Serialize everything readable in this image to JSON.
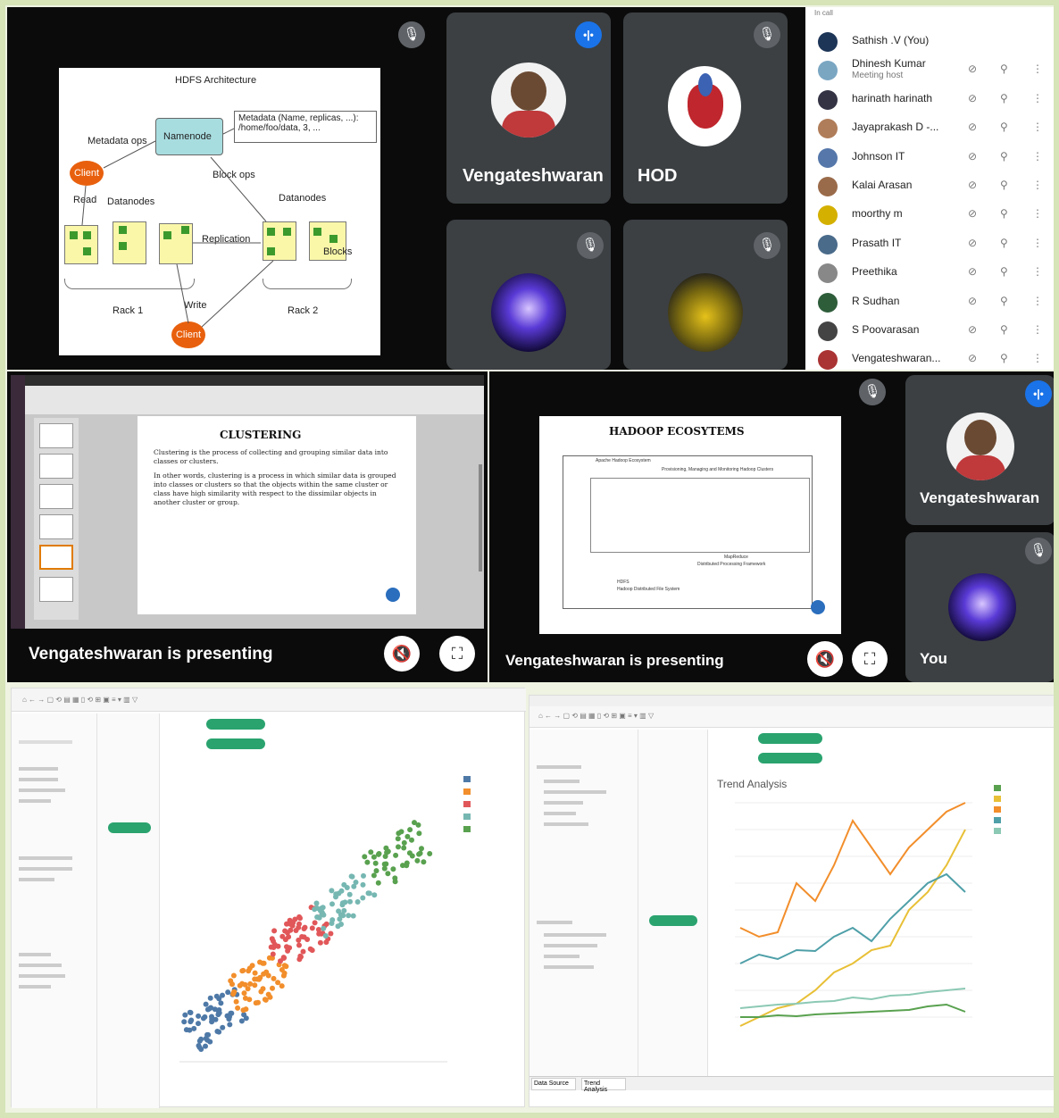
{
  "hdfs_slide": {
    "title": "HDFS Architecture",
    "namenode": "Namenode",
    "metadata": "Metadata (Name, replicas, ...):\n/home/foo/data, 3, ...",
    "metadata_ops": "Metadata ops",
    "client": "Client",
    "block_ops": "Block ops",
    "read": "Read",
    "datanodes_left": "Datanodes",
    "datanodes_right": "Datanodes",
    "replication": "Replication",
    "blocks": "Blocks",
    "rack1": "Rack 1",
    "rack2": "Rack 2",
    "write": "Write",
    "client2": "Client"
  },
  "tiles": {
    "vengateshwaran_top": "Vengateshwaran",
    "hod": "HOD",
    "vengateshwaran_right": "Vengateshwaran",
    "you": "You"
  },
  "people_panel": {
    "header": "In call",
    "participants": [
      {
        "name": "Sathish .V (You)",
        "sub": "",
        "color": "#1d3557"
      },
      {
        "name": "Dhinesh Kumar",
        "sub": "Meeting host",
        "color": "#7aa6c2"
      },
      {
        "name": "harinath harinath",
        "sub": "",
        "color": "#334"
      },
      {
        "name": "Jayaprakash D -...",
        "sub": "",
        "color": "#b07d5a"
      },
      {
        "name": "Johnson IT",
        "sub": "",
        "color": "#5577aa"
      },
      {
        "name": "Kalai Arasan",
        "sub": "",
        "color": "#9a6b4a"
      },
      {
        "name": "moorthy m",
        "sub": "",
        "color": "#d4b000"
      },
      {
        "name": "Prasath IT",
        "sub": "",
        "color": "#4a6b8a"
      },
      {
        "name": "Preethika",
        "sub": "",
        "color": "#888"
      },
      {
        "name": "R Sudhan",
        "sub": "",
        "color": "#2e5d3a"
      },
      {
        "name": "S Poovarasan",
        "sub": "",
        "color": "#444"
      },
      {
        "name": "Vengateshwaran...",
        "sub": "",
        "color": "#a33"
      }
    ]
  },
  "clustering_slide": {
    "title": "CLUSTERING",
    "bullet1": "Clustering is the process of collecting and grouping similar data into classes or clusters.",
    "bullet2": "In other words, clustering is a process in which similar data is grouped into classes or clusters so that the objects within the same cluster or class have high similarity with respect to the dissimilar objects in another cluster or group."
  },
  "hadoop_slide": {
    "title": "HADOOP ECOSYTEMS",
    "subtitle": "Apache Hadoop Ecosystem",
    "row1": "Provisioning, Managing and Monitoring Hadoop Clusters",
    "row2": "MapReduce",
    "row3": "Distributed Processing Framework",
    "row4": "HDFS",
    "row5": "Hadoop Distributed File System"
  },
  "presenting": {
    "left": "Vengateshwaran is presenting",
    "right": "Vengateshwaran is presenting"
  },
  "tableau_right": {
    "chart_title": "Trend Analysis",
    "tab1": "Data Source",
    "tab2": "Trend Analysis"
  },
  "colors": {
    "meet_tile": "#3c4043",
    "accent": "#1a73e8",
    "tableau_pill": "#2aa36f",
    "cluster1": "#4e79a7",
    "cluster2": "#f28e2b",
    "cluster3": "#e15759",
    "cluster4": "#76b7b2",
    "cluster5": "#59a14f"
  }
}
